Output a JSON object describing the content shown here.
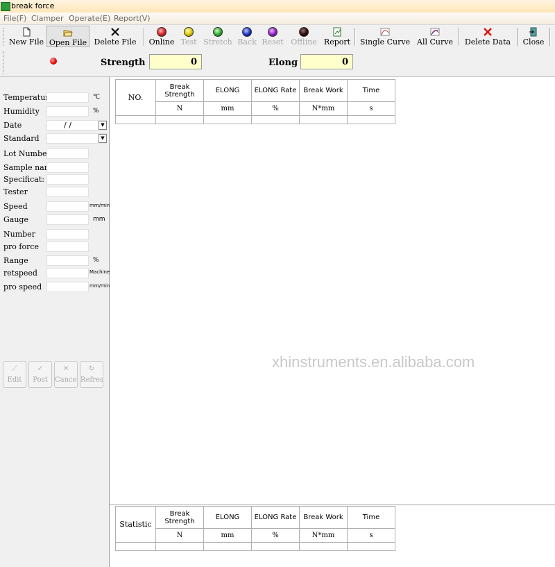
{
  "window": {
    "title": "break force"
  },
  "menu": [
    "File(F)",
    "Clamper",
    "Operate(E)",
    "Report(V)"
  ],
  "toolbar": {
    "buttons": [
      {
        "label": "New File",
        "icon": "new-file-icon",
        "enabled": true
      },
      {
        "label": "Open File",
        "icon": "open-folder-icon",
        "enabled": true,
        "pressed": true
      },
      {
        "label": "Delete File",
        "icon": "x-icon",
        "enabled": true
      },
      {
        "label": "Online",
        "icon": "red-circle-icon",
        "enabled": true
      },
      {
        "label": "Test",
        "icon": "yellow-circle-icon",
        "enabled": false
      },
      {
        "label": "Stretch",
        "icon": "green-circle-icon",
        "enabled": false
      },
      {
        "label": "Back",
        "icon": "blue-circle-icon",
        "enabled": false
      },
      {
        "label": "Reset",
        "icon": "purple-circle-icon",
        "enabled": false
      },
      {
        "label": "Offline",
        "icon": "black-circle-icon",
        "enabled": false
      },
      {
        "label": "Report",
        "icon": "report-icon",
        "enabled": true
      },
      {
        "label": "Single Curve",
        "icon": "single-curve-icon",
        "enabled": true
      },
      {
        "label": "All Curve",
        "icon": "all-curve-icon",
        "enabled": true
      },
      {
        "label": "Delete Data",
        "icon": "red-x-icon",
        "enabled": true
      },
      {
        "label": "Close",
        "icon": "close-door-icon",
        "enabled": true
      }
    ]
  },
  "readout": {
    "strength_label": "Strength",
    "strength_value": "0",
    "elong_label": "Elong",
    "elong_value": "0"
  },
  "fields": [
    {
      "label": "Temperature",
      "unit": "℃"
    },
    {
      "label": "Humidity",
      "unit": "%"
    },
    {
      "label": "Date",
      "value": "/ /",
      "dropdown": true
    },
    {
      "label": "Standard",
      "dropdown": true
    },
    {
      "label": "Lot Number"
    },
    {
      "label": "Sample name"
    },
    {
      "label": "Specificat:"
    },
    {
      "label": "Tester"
    },
    {
      "label": "Speed",
      "unit": "mm/min"
    },
    {
      "label": "Gauge",
      "unit": "mm"
    },
    {
      "label": "Number"
    },
    {
      "label": "pro force"
    },
    {
      "label": "Range",
      "unit": "%"
    },
    {
      "label": "retspeed",
      "unit": "Machine"
    },
    {
      "label": "pro speed",
      "unit": "mm/min"
    }
  ],
  "actions": [
    "Edit",
    "Post",
    "Cancel",
    "Refresh"
  ],
  "table": {
    "first_col": "NO.",
    "columns": [
      "Break Strength",
      "ELONG",
      "ELONG Rate",
      "Break Work",
      "Time"
    ],
    "units": [
      "N",
      "mm",
      "%",
      "N*mm",
      "s"
    ]
  },
  "stats_table": {
    "first_col": "Statistic",
    "columns": [
      "Break Strength",
      "ELONG",
      "ELONG Rate",
      "Break Work",
      "Time"
    ],
    "units": [
      "N",
      "mm",
      "%",
      "N*mm",
      "s"
    ]
  },
  "watermark": "xhinstruments.en.alibaba.com"
}
